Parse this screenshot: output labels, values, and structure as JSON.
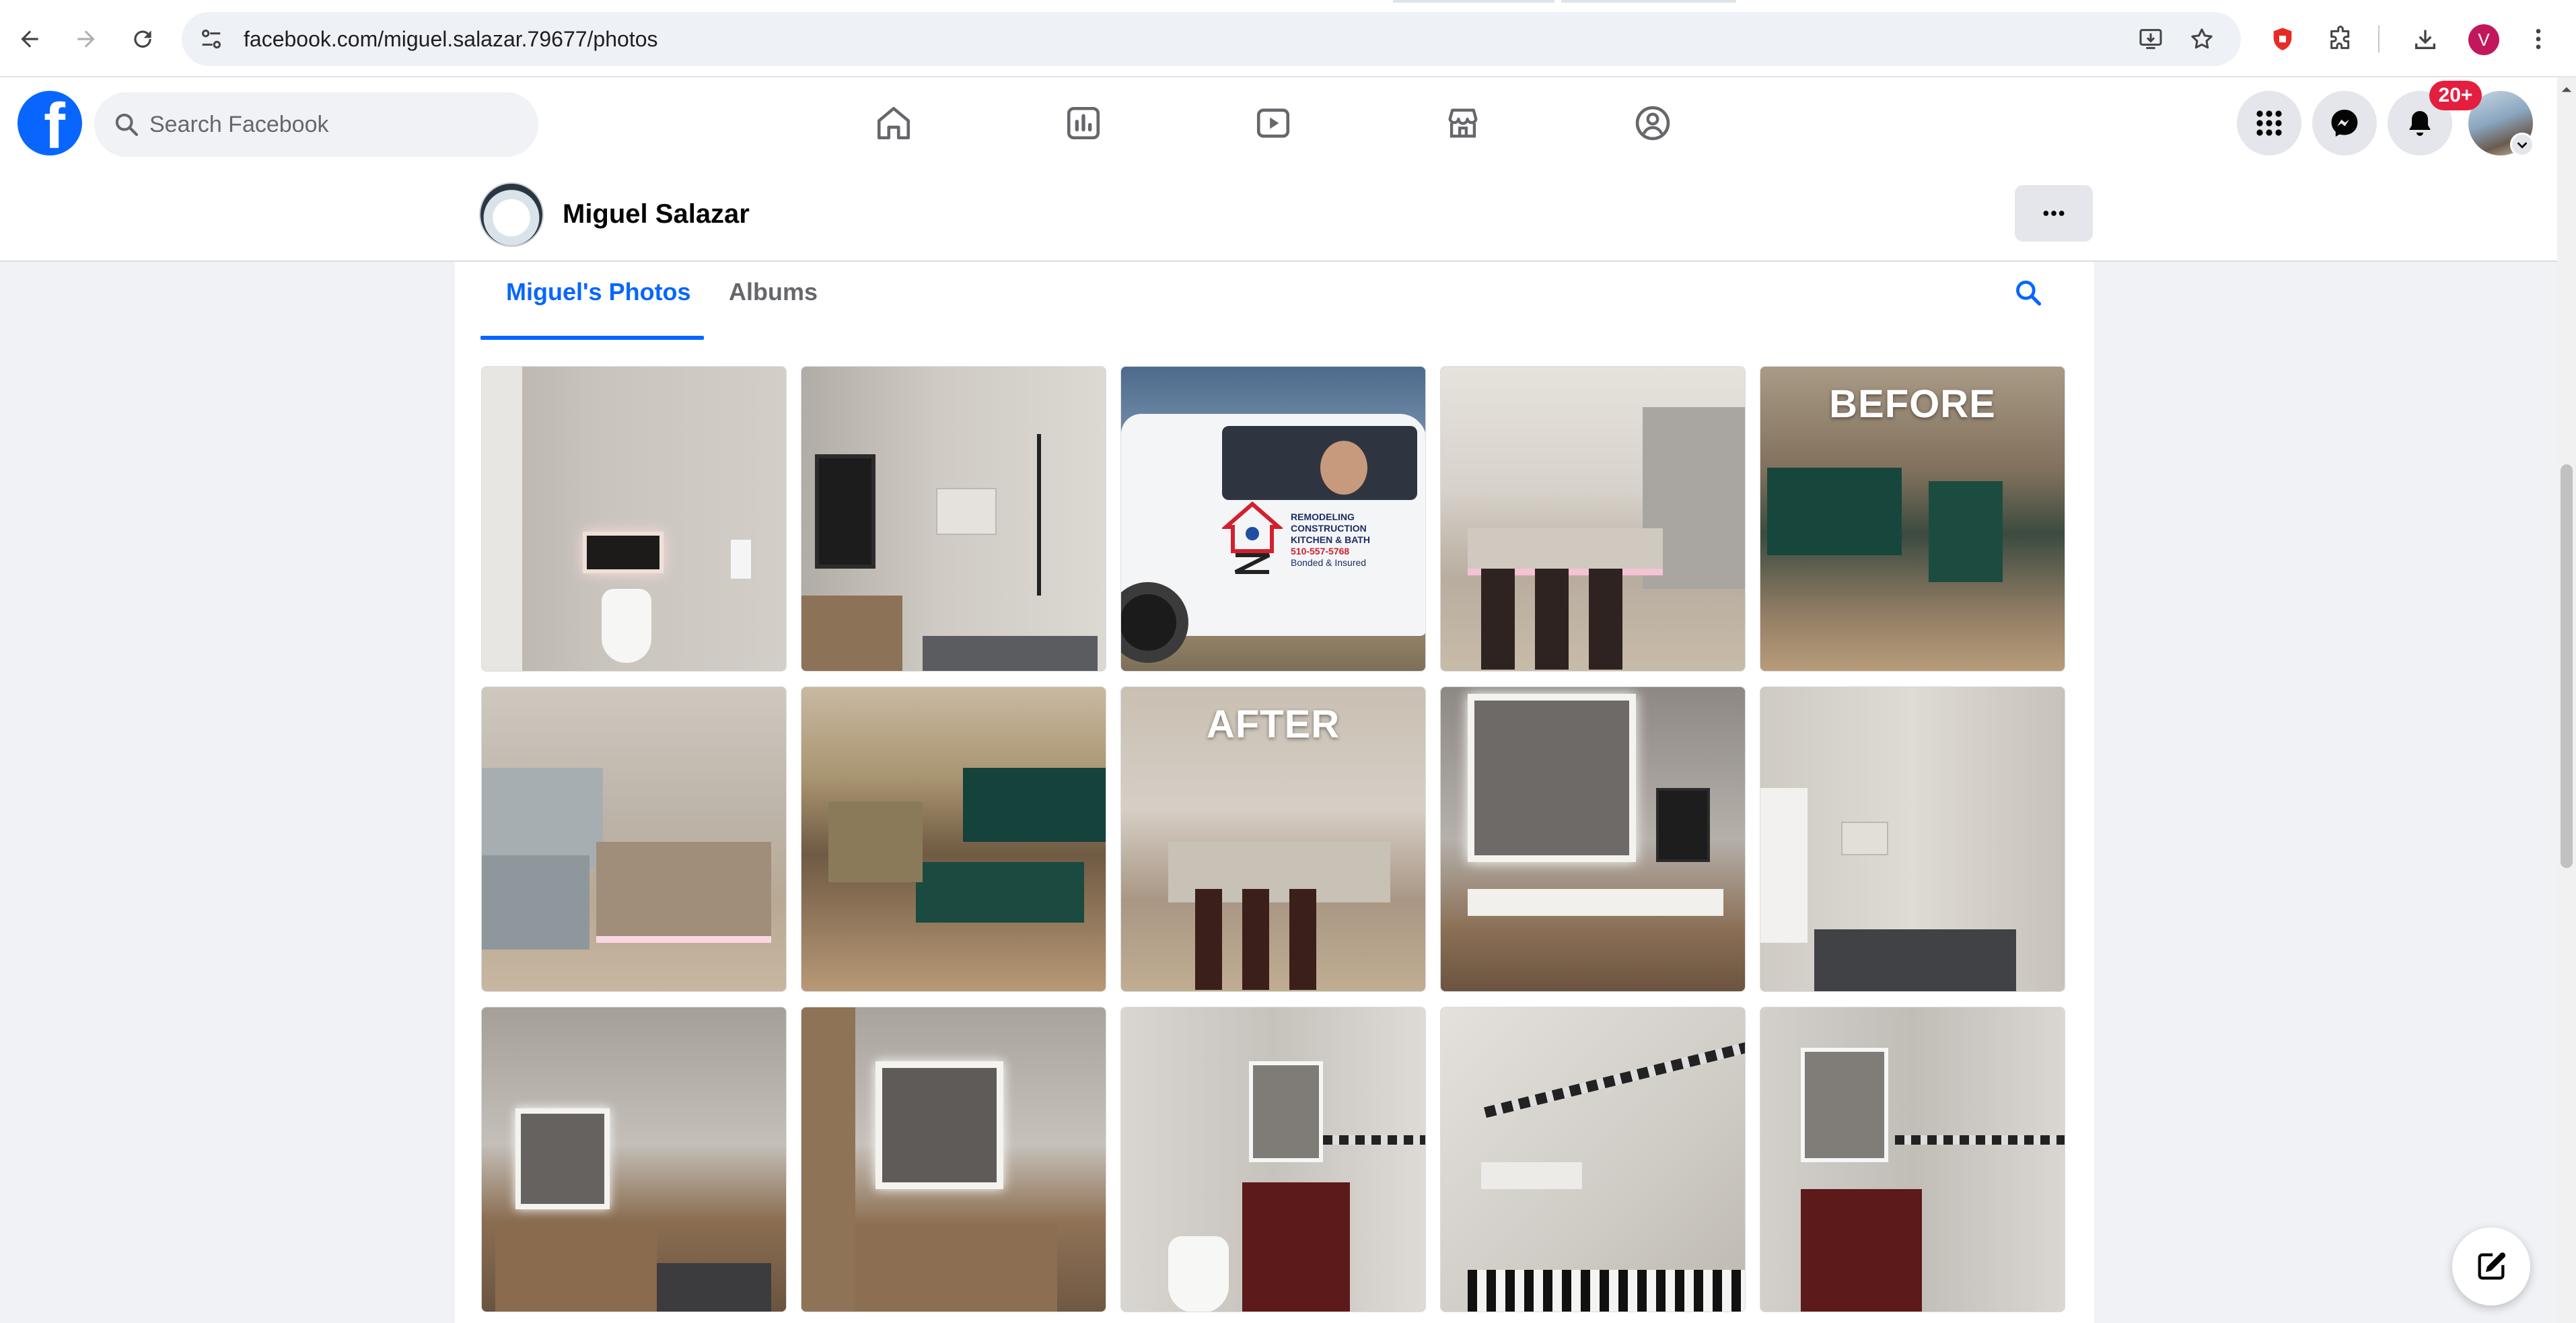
{
  "browser": {
    "url": "facebook.com/miguel.salazar.79677/photos",
    "profile_initial": "V"
  },
  "facebook": {
    "logo": "f",
    "search_placeholder": "Search Facebook",
    "notification_count": "20+"
  },
  "profile": {
    "name": "Miguel Salazar"
  },
  "photos_section": {
    "tabs": [
      "Miguel's Photos",
      "Albums"
    ],
    "active_tab": "Miguel's Photos",
    "photos": [
      {
        "scene": "bathroom-toilet-niche",
        "overlay": ""
      },
      {
        "scene": "walk-in-shower-glass",
        "overlay": ""
      },
      {
        "scene": "company-truck",
        "overlay": ""
      },
      {
        "scene": "kitchen-island-stools",
        "overlay": ""
      },
      {
        "scene": "kitchen-before",
        "overlay": "BEFORE"
      },
      {
        "scene": "kitchen-island-lit",
        "overlay": ""
      },
      {
        "scene": "kitchen-green-cabinets",
        "overlay": ""
      },
      {
        "scene": "kitchen-after",
        "overlay": "AFTER"
      },
      {
        "scene": "bathroom-vanity-mirror",
        "overlay": ""
      },
      {
        "scene": "shower-niche-hooks",
        "overlay": ""
      },
      {
        "scene": "bathroom-vanity-shower",
        "overlay": ""
      },
      {
        "scene": "double-vanity-mirror",
        "overlay": ""
      },
      {
        "scene": "bathroom-red-vanity",
        "overlay": ""
      },
      {
        "scene": "shower-bench-tile",
        "overlay": ""
      },
      {
        "scene": "bathroom-red-vanity-2",
        "overlay": ""
      }
    ]
  },
  "truck_decal": {
    "line1": "REMODELING",
    "line2": "CONSTRUCTION",
    "line3": "KITCHEN & BATH",
    "phone": "510-557-5768",
    "line5": "Bonded & Insured"
  },
  "colors": {
    "facebook_blue": "#0866ff",
    "notification_red": "#e41e3f",
    "page_background": "#f0f2f5"
  },
  "icons": [
    "back-arrow-icon",
    "forward-arrow-icon",
    "reload-icon",
    "site-info-icon",
    "install-app-icon",
    "bookmark-star-icon",
    "extension-shield-icon",
    "puzzle-extensions-icon",
    "download-icon",
    "kebab-menu-icon",
    "search-icon",
    "home-icon",
    "dashboard-icon",
    "video-icon",
    "marketplace-icon",
    "groups-icon",
    "menu-grid-icon",
    "messenger-icon",
    "bell-icon",
    "chevron-down-icon",
    "more-dots-icon",
    "compose-icon"
  ]
}
